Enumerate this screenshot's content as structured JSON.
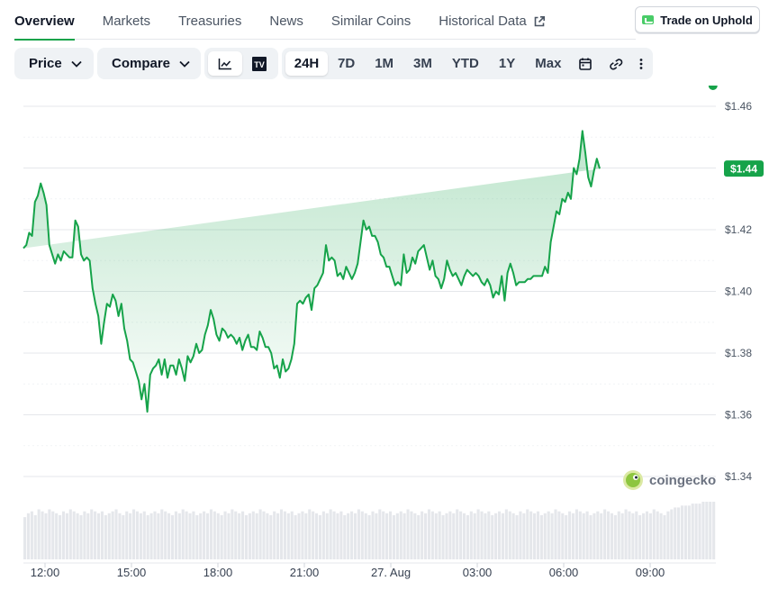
{
  "tabs": [
    {
      "label": "Overview"
    },
    {
      "label": "Markets"
    },
    {
      "label": "Treasuries"
    },
    {
      "label": "News"
    },
    {
      "label": "Similar Coins"
    },
    {
      "label": "Historical Data"
    }
  ],
  "trade_button": {
    "label": "Trade on Uphold",
    "icon": "uphold-icon"
  },
  "toolbar": {
    "price_label": "Price",
    "compare_label": "Compare",
    "ranges": [
      "24H",
      "7D",
      "1M",
      "3M",
      "YTD",
      "1Y",
      "Max"
    ],
    "active_range": "24H",
    "tradingview_label": "TV"
  },
  "colors": {
    "accent": "#16a34a",
    "line": "#16a34a",
    "badge_bg": "#16a34a"
  },
  "watermark": "coingecko",
  "chart_data": {
    "type": "area",
    "title": "",
    "xlabel": "",
    "ylabel": "",
    "ylim": [
      1.34,
      1.46
    ],
    "y_ticks": [
      "$1.46",
      "$1.44",
      "$1.42",
      "$1.40",
      "$1.38",
      "$1.36",
      "$1.34"
    ],
    "y_tick_values": [
      1.46,
      1.44,
      1.42,
      1.4,
      1.38,
      1.36,
      1.34
    ],
    "x_ticks": [
      "12:00",
      "15:00",
      "18:00",
      "21:00",
      "27. Aug",
      "03:00",
      "06:00",
      "09:00"
    ],
    "x_tick_hours": [
      0,
      3,
      6,
      9,
      12,
      15,
      18,
      21
    ],
    "xlim_hours": [
      -0.75,
      23.28
    ],
    "current_price_label": "$1.44",
    "current_price": 1.4398,
    "series": [
      {
        "x_hours": [
          -0.75,
          -0.65,
          -0.55,
          -0.45,
          -0.35,
          -0.25,
          -0.15,
          -0.05,
          0.05,
          0.15,
          0.25,
          0.35,
          0.45,
          0.55,
          0.65,
          0.75,
          0.85,
          0.95,
          1.05,
          1.15,
          1.25,
          1.35,
          1.45,
          1.55,
          1.65,
          1.75,
          1.85,
          1.95,
          2.05,
          2.15,
          2.25,
          2.35,
          2.45,
          2.55,
          2.65,
          2.75,
          2.85,
          2.95,
          3.05,
          3.15,
          3.25,
          3.35,
          3.45,
          3.55,
          3.65,
          3.75,
          3.85,
          3.95,
          4.05,
          4.15,
          4.25,
          4.35,
          4.45,
          4.55,
          4.65,
          4.75,
          4.85,
          4.95,
          5.05,
          5.15,
          5.25,
          5.35,
          5.45,
          5.55,
          5.65,
          5.75,
          5.85,
          5.95,
          6.05,
          6.15,
          6.25,
          6.35,
          6.45,
          6.55,
          6.65,
          6.75,
          6.85,
          6.95,
          7.05,
          7.15,
          7.25,
          7.35,
          7.45,
          7.55,
          7.65,
          7.75,
          7.85,
          7.95,
          8.05,
          8.15,
          8.25,
          8.35,
          8.45,
          8.55,
          8.65,
          8.75,
          8.85,
          8.95,
          9.05,
          9.15,
          9.25,
          9.35,
          9.45,
          9.55,
          9.65,
          9.75,
          9.85,
          9.95,
          10.05,
          10.15,
          10.25,
          10.35,
          10.45,
          10.55,
          10.65,
          10.75,
          10.85,
          10.95,
          11.05,
          11.15,
          11.25,
          11.35,
          11.45,
          11.55,
          11.65,
          11.75,
          11.85,
          11.95,
          12.05,
          12.15,
          12.25,
          12.35,
          12.45,
          12.55,
          12.65,
          12.75,
          12.85,
          12.95,
          13.05,
          13.15,
          13.25,
          13.35,
          13.45,
          13.55,
          13.65,
          13.75,
          13.85,
          13.95,
          14.05,
          14.15,
          14.25,
          14.35,
          14.45,
          14.55,
          14.65,
          14.75,
          14.85,
          14.95,
          15.05,
          15.15,
          15.25,
          15.35,
          15.45,
          15.55,
          15.65,
          15.75,
          15.85,
          15.95,
          16.05,
          16.15,
          16.25,
          16.35,
          16.45,
          16.55,
          16.65,
          16.75,
          16.85,
          16.95,
          17.05,
          17.15,
          17.25,
          17.35,
          17.45,
          17.55,
          17.65,
          17.75,
          17.85,
          17.95,
          18.05,
          18.15,
          18.25,
          18.35,
          18.45,
          18.55,
          18.65,
          18.75,
          18.85,
          18.95,
          19.05,
          19.15,
          19.25,
          19.35,
          19.45,
          19.55,
          19.65,
          19.75,
          19.85,
          19.95,
          20.05,
          20.15,
          20.25,
          20.35,
          20.45,
          20.55,
          20.65,
          20.75,
          20.85,
          20.95,
          21.05,
          21.15,
          21.25,
          21.35,
          21.45,
          21.55,
          21.65,
          21.75,
          21.85,
          21.95,
          22.05,
          22.15,
          22.25,
          22.35,
          22.45,
          22.55,
          22.65,
          22.75,
          22.85,
          22.95,
          23.05,
          23.18
        ],
        "values": [
          1.414,
          1.415,
          1.419,
          1.418,
          1.429,
          1.431,
          1.435,
          1.432,
          1.428,
          1.415,
          1.412,
          1.409,
          1.412,
          1.41,
          1.413,
          1.412,
          1.411,
          1.411,
          1.423,
          1.421,
          1.412,
          1.41,
          1.411,
          1.41,
          1.401,
          1.396,
          1.392,
          1.383,
          1.39,
          1.396,
          1.395,
          1.399,
          1.397,
          1.392,
          1.396,
          1.388,
          1.384,
          1.378,
          1.377,
          1.374,
          1.371,
          1.365,
          1.37,
          1.361,
          1.373,
          1.375,
          1.376,
          1.378,
          1.373,
          1.378,
          1.372,
          1.376,
          1.376,
          1.373,
          1.378,
          1.375,
          1.371,
          1.379,
          1.377,
          1.379,
          1.383,
          1.38,
          1.381,
          1.386,
          1.389,
          1.394,
          1.391,
          1.386,
          1.384,
          1.388,
          1.387,
          1.385,
          1.386,
          1.385,
          1.383,
          1.385,
          1.381,
          1.384,
          1.386,
          1.382,
          1.382,
          1.381,
          1.387,
          1.385,
          1.382,
          1.382,
          1.38,
          1.375,
          1.376,
          1.372,
          1.378,
          1.374,
          1.375,
          1.378,
          1.383,
          1.396,
          1.397,
          1.396,
          1.398,
          1.399,
          1.394,
          1.401,
          1.402,
          1.404,
          1.406,
          1.415,
          1.41,
          1.411,
          1.41,
          1.405,
          1.406,
          1.404,
          1.408,
          1.406,
          1.404,
          1.406,
          1.409,
          1.416,
          1.423,
          1.42,
          1.421,
          1.418,
          1.418,
          1.416,
          1.412,
          1.411,
          1.408,
          1.408,
          1.405,
          1.402,
          1.403,
          1.402,
          1.412,
          1.406,
          1.407,
          1.411,
          1.409,
          1.413,
          1.414,
          1.415,
          1.411,
          1.407,
          1.41,
          1.405,
          1.404,
          1.401,
          1.404,
          1.41,
          1.407,
          1.405,
          1.406,
          1.404,
          1.402,
          1.405,
          1.407,
          1.406,
          1.405,
          1.406,
          1.405,
          1.403,
          1.402,
          1.404,
          1.402,
          1.398,
          1.4,
          1.399,
          1.405,
          1.397,
          1.406,
          1.409,
          1.406,
          1.402,
          1.403,
          1.403,
          1.403,
          1.404,
          1.404,
          1.405,
          1.405,
          1.405,
          1.405,
          1.408,
          1.406,
          1.416,
          1.421,
          1.426,
          1.425,
          1.43,
          1.429,
          1.432,
          1.43,
          1.44,
          1.438,
          1.443,
          1.452,
          1.445,
          1.437,
          1.434,
          1.439,
          1.443,
          1.4398
        ]
      }
    ],
    "volume": {
      "values": [
        0.22,
        0.24,
        0.25,
        0.23,
        0.26,
        0.25,
        0.24,
        0.26,
        0.25,
        0.24,
        0.23,
        0.25,
        0.24,
        0.26,
        0.25,
        0.24,
        0.23,
        0.25,
        0.24,
        0.26,
        0.25,
        0.24,
        0.25,
        0.23,
        0.24,
        0.25,
        0.26,
        0.24,
        0.23,
        0.25,
        0.24,
        0.26,
        0.25,
        0.24,
        0.25,
        0.23,
        0.24,
        0.25,
        0.24,
        0.26,
        0.25,
        0.24,
        0.23,
        0.25,
        0.24,
        0.26,
        0.25,
        0.24,
        0.25,
        0.23,
        0.24,
        0.25,
        0.24,
        0.26,
        0.25,
        0.24,
        0.23,
        0.25,
        0.24,
        0.26,
        0.25,
        0.24,
        0.25,
        0.23,
        0.24,
        0.25,
        0.24,
        0.26,
        0.25,
        0.24,
        0.23,
        0.25,
        0.24,
        0.26,
        0.25,
        0.24,
        0.25,
        0.23,
        0.24,
        0.25,
        0.24,
        0.26,
        0.25,
        0.24,
        0.23,
        0.25,
        0.24,
        0.26,
        0.25,
        0.24,
        0.25,
        0.23,
        0.24,
        0.25,
        0.24,
        0.26,
        0.25,
        0.24,
        0.23,
        0.25,
        0.24,
        0.26,
        0.25,
        0.24,
        0.25,
        0.23,
        0.24,
        0.25,
        0.24,
        0.26,
        0.25,
        0.24,
        0.23,
        0.25,
        0.24,
        0.26,
        0.25,
        0.24,
        0.25,
        0.23,
        0.24,
        0.25,
        0.24,
        0.26,
        0.25,
        0.24,
        0.23,
        0.25,
        0.24,
        0.26,
        0.25,
        0.24,
        0.25,
        0.23,
        0.24,
        0.25,
        0.24,
        0.26,
        0.25,
        0.24,
        0.23,
        0.25,
        0.24,
        0.26,
        0.25,
        0.24,
        0.25,
        0.23,
        0.24,
        0.25,
        0.24,
        0.26,
        0.25,
        0.24,
        0.23,
        0.25,
        0.24,
        0.26,
        0.25,
        0.24,
        0.25,
        0.23,
        0.24,
        0.25,
        0.24,
        0.26,
        0.25,
        0.24,
        0.23,
        0.25,
        0.24,
        0.26,
        0.25,
        0.24,
        0.25,
        0.23,
        0.24,
        0.25,
        0.24,
        0.26,
        0.25,
        0.24,
        0.23,
        0.25,
        0.26,
        0.27,
        0.27,
        0.28,
        0.28,
        0.28,
        0.29,
        0.29,
        0.29,
        0.3,
        0.3,
        0.3,
        0.3
      ]
    }
  }
}
